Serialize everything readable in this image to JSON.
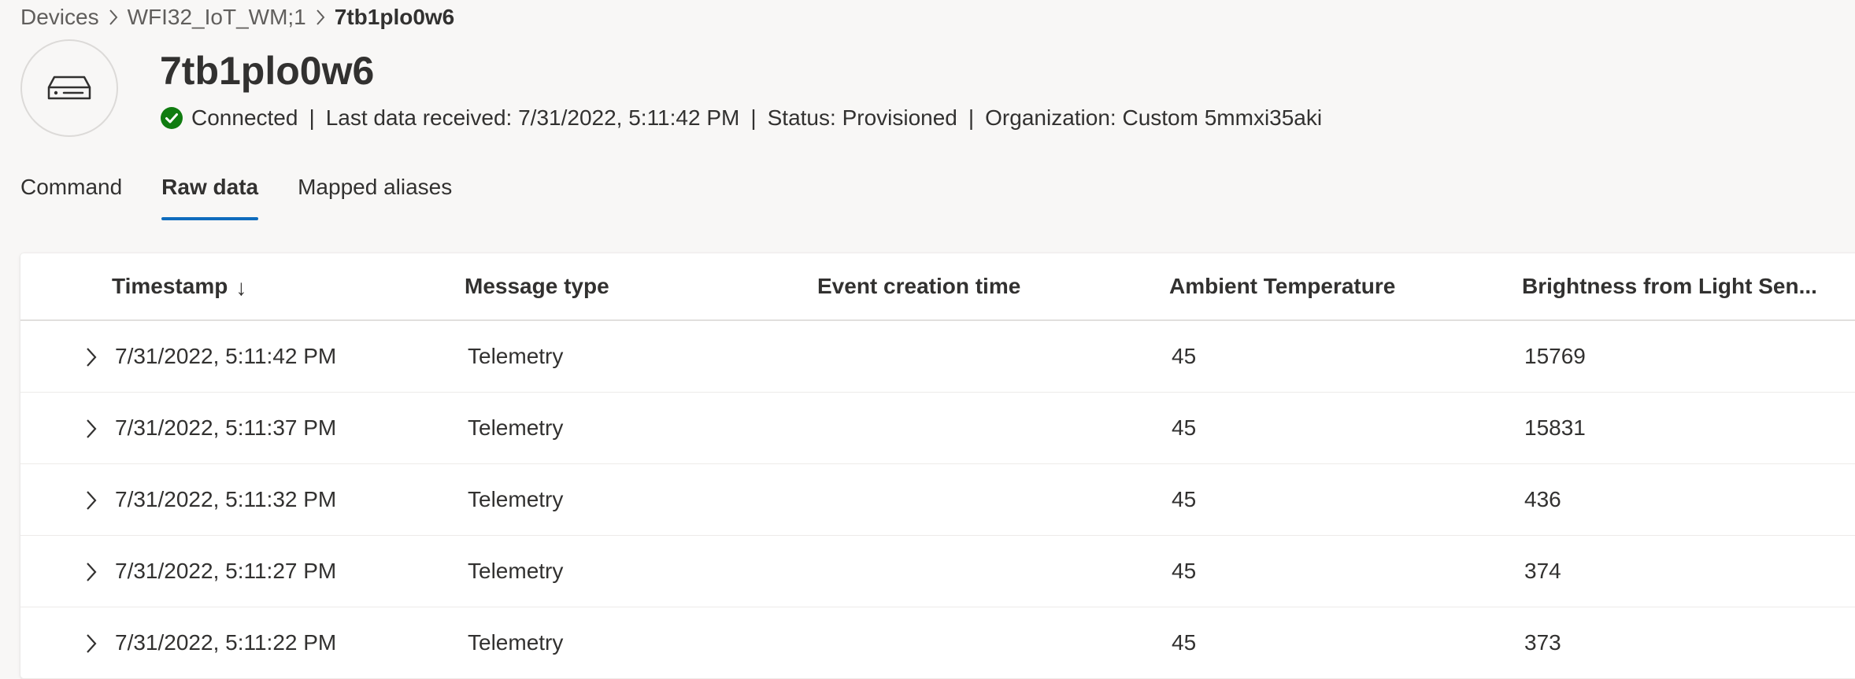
{
  "breadcrumb": {
    "items": [
      "Devices",
      "WFI32_IoT_WM;1",
      "7tb1plo0w6"
    ]
  },
  "device": {
    "name": "7tb1plo0w6",
    "connection": "Connected",
    "last_data": "Last data received: 7/31/2022, 5:11:42 PM",
    "status": "Status: Provisioned",
    "organization": "Organization: Custom 5mmxi35aki",
    "separator": "|"
  },
  "tabs": [
    {
      "label": "Command",
      "active": false
    },
    {
      "label": "Raw data",
      "active": true
    },
    {
      "label": "Mapped aliases",
      "active": false
    }
  ],
  "table": {
    "columns": [
      "Timestamp",
      "Message type",
      "Event creation time",
      "Ambient Temperature",
      "Brightness from Light Sen..."
    ],
    "sort_indicator": "↓",
    "rows": [
      [
        "7/31/2022, 5:11:42 PM",
        "Telemetry",
        "",
        "45",
        "15769"
      ],
      [
        "7/31/2022, 5:11:37 PM",
        "Telemetry",
        "",
        "45",
        "15831"
      ],
      [
        "7/31/2022, 5:11:32 PM",
        "Telemetry",
        "",
        "45",
        "436"
      ],
      [
        "7/31/2022, 5:11:27 PM",
        "Telemetry",
        "",
        "45",
        "374"
      ],
      [
        "7/31/2022, 5:11:22 PM",
        "Telemetry",
        "",
        "45",
        "373"
      ]
    ]
  },
  "colors": {
    "accent": "#0f6cbd",
    "success": "#107c10",
    "background": "#f8f7f6"
  },
  "icons": {
    "avatar": "device-icon",
    "status": "check-circle-icon",
    "breadcrumb_separator": "chevron-right-icon",
    "row_expand": "chevron-right-icon"
  }
}
